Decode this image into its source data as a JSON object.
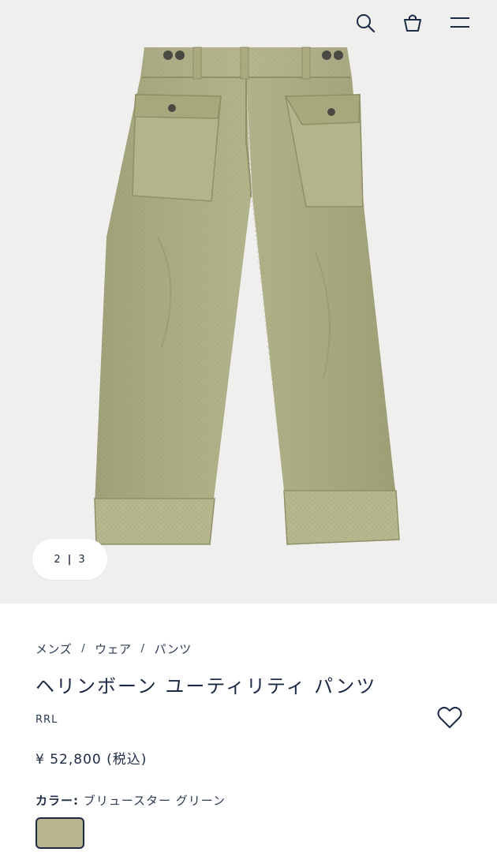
{
  "header": {
    "icons": [
      "search-icon",
      "shopping-bag-icon",
      "menu-icon"
    ]
  },
  "gallery": {
    "current": "2",
    "total": "3",
    "separator": "|"
  },
  "breadcrumb": {
    "items": [
      "メンズ",
      "ウェア",
      "パンツ"
    ],
    "separator": "/"
  },
  "product": {
    "title": "ヘリンボーン ユーティリティ パンツ",
    "brand": "RRL",
    "price": "¥ 52,800 (税込)",
    "color_label": "カラー:",
    "color_value": "ブリュースター グリーン"
  },
  "colors": {
    "accent": "#1c2a44",
    "hero_bg": "#efefee",
    "pant_olive": "#aeaf84"
  }
}
